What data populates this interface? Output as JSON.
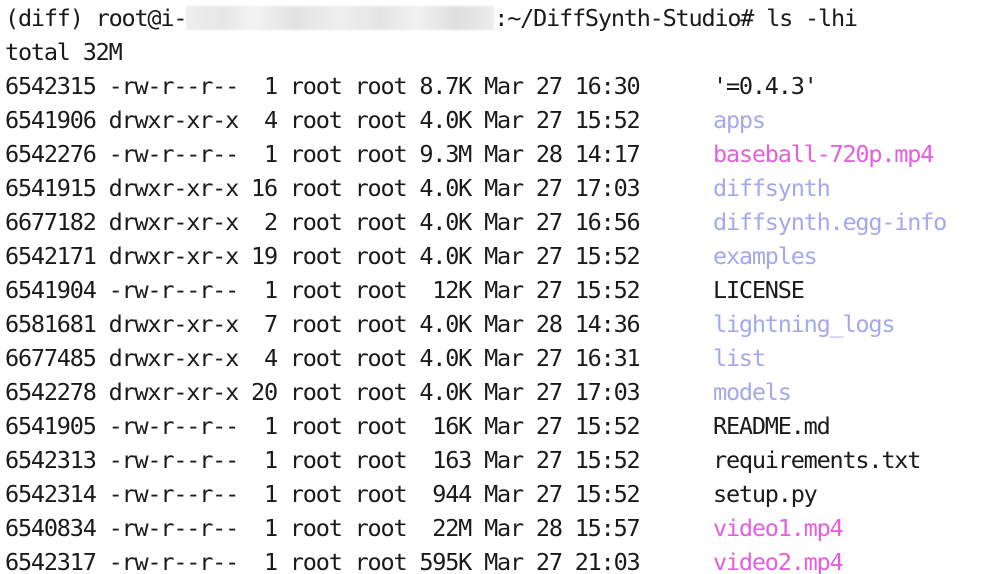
{
  "colors": {
    "background": "#ffffff",
    "text": "#1a1a1a",
    "directory": "#a6a8ec",
    "media": "#e45fdc",
    "plain": "#1a1a1a"
  },
  "prompt": {
    "prefix": "(diff) root@i-",
    "suffix": ":~/DiffSynth-Studio#",
    "command": "ls -lhi"
  },
  "total": "total 32M",
  "entries": [
    {
      "inode": "6542315",
      "perms": "-rw-r--r--",
      "links": "1",
      "owner": "root",
      "group": "root",
      "size": "8.7K",
      "month": "Mar",
      "day": "27",
      "time": "16:30",
      "name": "'=0.4.3'",
      "kind": "plain"
    },
    {
      "inode": "6541906",
      "perms": "drwxr-xr-x",
      "links": "4",
      "owner": "root",
      "group": "root",
      "size": "4.0K",
      "month": "Mar",
      "day": "27",
      "time": "15:52",
      "name": "apps",
      "kind": "directory"
    },
    {
      "inode": "6542276",
      "perms": "-rw-r--r--",
      "links": "1",
      "owner": "root",
      "group": "root",
      "size": "9.3M",
      "month": "Mar",
      "day": "28",
      "time": "14:17",
      "name": "baseball-720p.mp4",
      "kind": "media"
    },
    {
      "inode": "6541915",
      "perms": "drwxr-xr-x",
      "links": "16",
      "owner": "root",
      "group": "root",
      "size": "4.0K",
      "month": "Mar",
      "day": "27",
      "time": "17:03",
      "name": "diffsynth",
      "kind": "directory"
    },
    {
      "inode": "6677182",
      "perms": "drwxr-xr-x",
      "links": "2",
      "owner": "root",
      "group": "root",
      "size": "4.0K",
      "month": "Mar",
      "day": "27",
      "time": "16:56",
      "name": "diffsynth.egg-info",
      "kind": "directory"
    },
    {
      "inode": "6542171",
      "perms": "drwxr-xr-x",
      "links": "19",
      "owner": "root",
      "group": "root",
      "size": "4.0K",
      "month": "Mar",
      "day": "27",
      "time": "15:52",
      "name": "examples",
      "kind": "directory"
    },
    {
      "inode": "6541904",
      "perms": "-rw-r--r--",
      "links": "1",
      "owner": "root",
      "group": "root",
      "size": "12K",
      "month": "Mar",
      "day": "27",
      "time": "15:52",
      "name": "LICENSE",
      "kind": "plain"
    },
    {
      "inode": "6581681",
      "perms": "drwxr-xr-x",
      "links": "7",
      "owner": "root",
      "group": "root",
      "size": "4.0K",
      "month": "Mar",
      "day": "28",
      "time": "14:36",
      "name": "lightning_logs",
      "kind": "directory"
    },
    {
      "inode": "6677485",
      "perms": "drwxr-xr-x",
      "links": "4",
      "owner": "root",
      "group": "root",
      "size": "4.0K",
      "month": "Mar",
      "day": "27",
      "time": "16:31",
      "name": "list",
      "kind": "directory"
    },
    {
      "inode": "6542278",
      "perms": "drwxr-xr-x",
      "links": "20",
      "owner": "root",
      "group": "root",
      "size": "4.0K",
      "month": "Mar",
      "day": "27",
      "time": "17:03",
      "name": "models",
      "kind": "directory"
    },
    {
      "inode": "6541905",
      "perms": "-rw-r--r--",
      "links": "1",
      "owner": "root",
      "group": "root",
      "size": "16K",
      "month": "Mar",
      "day": "27",
      "time": "15:52",
      "name": "README.md",
      "kind": "plain"
    },
    {
      "inode": "6542313",
      "perms": "-rw-r--r--",
      "links": "1",
      "owner": "root",
      "group": "root",
      "size": "163",
      "month": "Mar",
      "day": "27",
      "time": "15:52",
      "name": "requirements.txt",
      "kind": "plain"
    },
    {
      "inode": "6542314",
      "perms": "-rw-r--r--",
      "links": "1",
      "owner": "root",
      "group": "root",
      "size": "944",
      "month": "Mar",
      "day": "27",
      "time": "15:52",
      "name": "setup.py",
      "kind": "plain"
    },
    {
      "inode": "6540834",
      "perms": "-rw-r--r--",
      "links": "1",
      "owner": "root",
      "group": "root",
      "size": "22M",
      "month": "Mar",
      "day": "28",
      "time": "15:57",
      "name": "video1.mp4",
      "kind": "media"
    },
    {
      "inode": "6542317",
      "perms": "-rw-r--r--",
      "links": "1",
      "owner": "root",
      "group": "root",
      "size": "595K",
      "month": "Mar",
      "day": "27",
      "time": "21:03",
      "name": "video2.mp4",
      "kind": "media"
    }
  ]
}
